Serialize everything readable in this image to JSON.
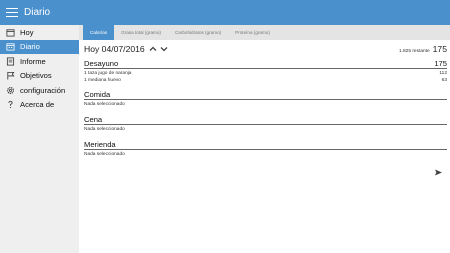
{
  "app": {
    "title": "Diario"
  },
  "icons": {
    "menu": "hamburger-icon",
    "up": "chevron-up-icon",
    "down": "chevron-down-icon",
    "send": "send-icon"
  },
  "sidebar": {
    "items": [
      {
        "label": "Hoy",
        "icon": "calendar-icon",
        "active": false
      },
      {
        "label": "Diario",
        "icon": "calendar-grid-icon",
        "active": true
      },
      {
        "label": "Informe",
        "icon": "report-icon",
        "active": false
      },
      {
        "label": "Objetivos",
        "icon": "flag-icon",
        "active": false
      },
      {
        "label": "configuración",
        "icon": "gear-icon",
        "active": false
      },
      {
        "label": "Acerca de",
        "icon": "question-icon",
        "active": false
      }
    ]
  },
  "tabs": [
    {
      "label": "Calorías",
      "active": true
    },
    {
      "label": "Grasa total (gramo)",
      "active": false
    },
    {
      "label": "Carbohidratos (gramo)",
      "active": false
    },
    {
      "label": "Proteína (gramo)",
      "active": false
    }
  ],
  "header": {
    "date": "Hoy 04/07/2016",
    "remaining_label": "1.825 restante",
    "remaining_value": "175"
  },
  "meals": [
    {
      "title": "Desayuno",
      "total": "175",
      "items": [
        {
          "name": "1 taza jugo de naranja",
          "cal": "112"
        },
        {
          "name": "1 mediana huevo",
          "cal": "63"
        }
      ]
    },
    {
      "title": "Comida",
      "total": "",
      "empty": "Nada seleccionado"
    },
    {
      "title": "Cena",
      "total": "",
      "empty": "Nada seleccionado"
    },
    {
      "title": "Merienda",
      "total": "",
      "empty": "Nada seleccionado"
    }
  ],
  "colors": {
    "accent": "#4a90cc",
    "sidebar_bg": "#efefef",
    "tabs_bg": "#e4e4e4"
  }
}
